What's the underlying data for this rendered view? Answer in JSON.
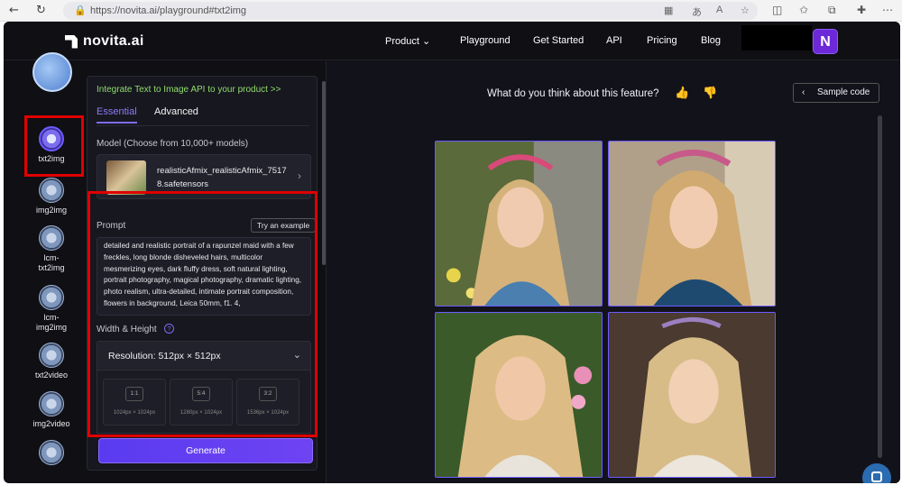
{
  "browser": {
    "url": "https://novita.ai/playground#txt2img"
  },
  "brand": {
    "name": "novita.ai"
  },
  "nav": {
    "items": [
      "Product",
      "Playground",
      "Get Started",
      "API",
      "Pricing",
      "Blog"
    ],
    "avatar_initial": "N"
  },
  "rail": {
    "items": [
      {
        "label": "txt2img",
        "active": true
      },
      {
        "label": "img2img"
      },
      {
        "label": "lcm-txt2img"
      },
      {
        "label": "lcm-img2img"
      },
      {
        "label": "txt2video"
      },
      {
        "label": "img2video"
      }
    ]
  },
  "panel": {
    "promo": "Integrate Text to Image API to your product >>",
    "tabs": [
      "Essential",
      "Advanced"
    ],
    "model_label": "Model (Choose from 10,000+ models)",
    "model_name": "realisticAfmix_realisticAfmix_75178.safetensors",
    "prompt_label": "Prompt",
    "try_example": "Try an example",
    "prompt_text": "detailed and realistic portrait of a rapunzel maid with a few freckles, long blonde disheveled hairs, multicolor mesmerizing eyes, dark fluffy dress, soft natural lighting, portrait photography, magical photography, dramatic lighting, photo realism, ultra-detailed, intimate portrait composition, flowers in background, Leica 50mm, f1. 4,",
    "wh_label": "Width & Height",
    "resolution": "Resolution: 512px × 512px",
    "ratios": [
      {
        "ratio": "1:1",
        "size": "1024px × 1024px"
      },
      {
        "ratio": "5:4",
        "size": "1280px × 1024px"
      },
      {
        "ratio": "3:2",
        "size": "1536px × 1024px"
      }
    ],
    "generate": "Generate"
  },
  "results": {
    "feedback_question": "What do you think about this feature?",
    "sample_code": "Sample code"
  },
  "colors": {
    "accent": "#6d5bff",
    "highlight": "#e00000",
    "promo": "#8fdc6d"
  }
}
